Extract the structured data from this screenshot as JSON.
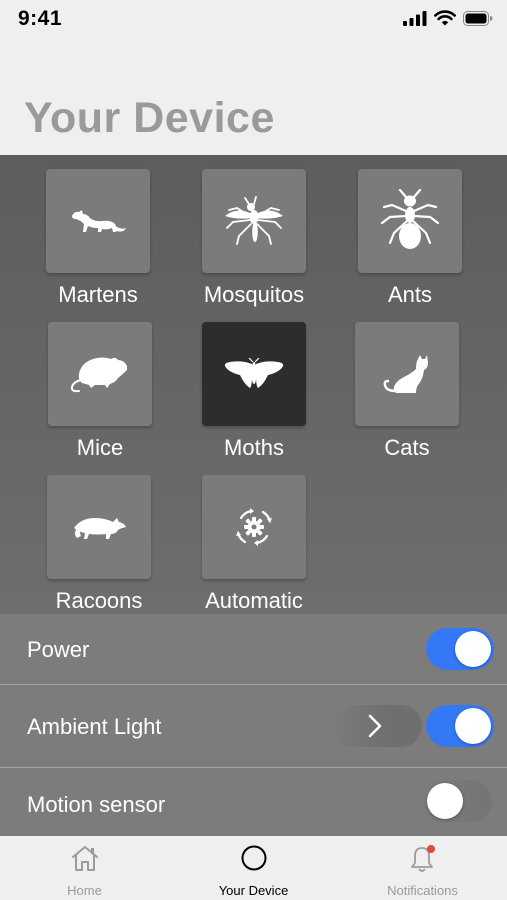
{
  "status": {
    "time": "9:41"
  },
  "title": "Your Device",
  "pests": [
    {
      "label": "Martens",
      "icon": "marten-icon",
      "selected": false
    },
    {
      "label": "Mosquitos",
      "icon": "mosquito-icon",
      "selected": false
    },
    {
      "label": "Ants",
      "icon": "ant-icon",
      "selected": false
    },
    {
      "label": "Mice",
      "icon": "mouse-icon",
      "selected": false
    },
    {
      "label": "Moths",
      "icon": "moth-icon",
      "selected": true
    },
    {
      "label": "Cats",
      "icon": "cat-icon",
      "selected": false
    },
    {
      "label": "Racoons",
      "icon": "racoon-icon",
      "selected": false
    },
    {
      "label": "Automatic",
      "icon": "auto-cycle-icon",
      "selected": false
    }
  ],
  "settings": {
    "power": {
      "label": "Power",
      "on": true
    },
    "ambient_light": {
      "label": "Ambient Light",
      "on": true
    },
    "motion_sensor": {
      "label": "Motion sensor",
      "on": false
    }
  },
  "tabs": [
    {
      "label": "Home",
      "icon": "home-icon",
      "active": false
    },
    {
      "label": "Your Device",
      "icon": "device-circle-icon",
      "active": true
    },
    {
      "label": "Notifications",
      "icon": "bell-icon",
      "active": false,
      "badge": true
    }
  ],
  "colors": {
    "accent": "#3478f6",
    "selected_tile": "#2d2d2d",
    "badge": "#e8453c"
  }
}
